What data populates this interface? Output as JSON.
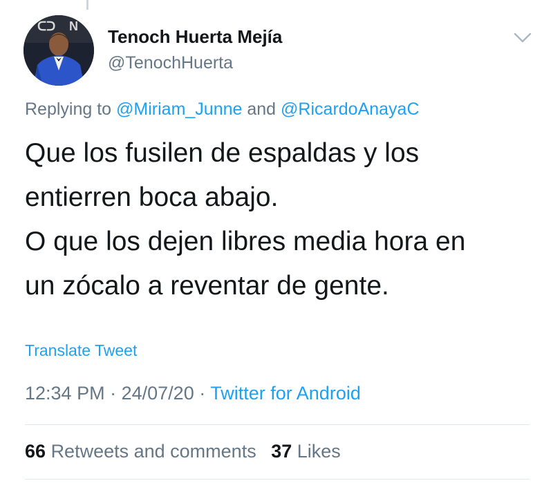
{
  "author": {
    "display_name": "Tenoch Huerta Mejía",
    "handle": "@TenochHuerta"
  },
  "icons": {
    "avatar": "profile-photo",
    "menu": "chevron-down-icon"
  },
  "reply": {
    "prefix": "Replying to",
    "mention_1": "@Miriam_Junne",
    "conjunction": "and",
    "mention_2": "@RicardoAnayaC"
  },
  "tweet": {
    "lines": [
      "Que los fusilen de espaldas y los",
      "entierren boca abajo.",
      "O que los dejen libres media hora en",
      "un zócalo a reventar de gente."
    ],
    "translate_label": "Translate Tweet"
  },
  "meta": {
    "time": "12:34 PM",
    "separator": "·",
    "date": "24/07/20",
    "source": "Twitter for Android"
  },
  "stats": {
    "retweets_count": "66",
    "retweets_label": "Retweets and comments",
    "likes_count": "37",
    "likes_label": "Likes"
  },
  "colors": {
    "link": "#1da1f2",
    "secondary_text": "#657786",
    "primary_text": "#14171a",
    "divider": "#e1e8ed"
  }
}
